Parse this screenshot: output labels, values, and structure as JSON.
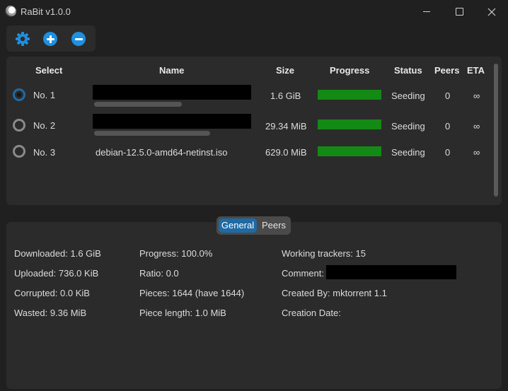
{
  "app": {
    "title": "RaBit v1.0.0",
    "accent_color": "#1f6aa5",
    "progress_color": "#138a13"
  },
  "toolbar": {
    "settings_icon": "gear-icon",
    "add_icon": "plus-circle-icon",
    "remove_icon": "minus-circle-icon"
  },
  "table": {
    "headers": {
      "select": "Select",
      "name": "Name",
      "size": "Size",
      "progress": "Progress",
      "status": "Status",
      "peers": "Peers",
      "eta": "ETA"
    },
    "rows": [
      {
        "select_label": "No. 1",
        "selected": true,
        "name": "",
        "name_redacted": true,
        "size": "1.6 GiB",
        "progress": 1.0,
        "status": "Seeding",
        "peers": "0",
        "eta": "∞"
      },
      {
        "select_label": "No. 2",
        "selected": false,
        "name": "",
        "name_redacted": true,
        "size": "29.34 MiB",
        "progress": 1.0,
        "status": "Seeding",
        "peers": "0",
        "eta": "∞"
      },
      {
        "select_label": "No. 3",
        "selected": false,
        "name": "debian-12.5.0-amd64-netinst.iso",
        "name_redacted": false,
        "size": "629.0 MiB",
        "progress": 1.0,
        "status": "Seeding",
        "peers": "0",
        "eta": "∞"
      }
    ]
  },
  "details": {
    "tabs": {
      "general": "General",
      "peers": "Peers",
      "active": "General"
    },
    "downloaded": "Downloaded: 1.6 GiB",
    "uploaded": "Uploaded: 736.0 KiB",
    "corrupted": "Corrupted: 0.0 KiB",
    "wasted": "Wasted: 9.36 MiB",
    "progress": "Progress: 100.0%",
    "ratio": "Ratio: 0.0",
    "pieces": "Pieces: 1644 (have 1644)",
    "piece_length": "Piece length: 1.0 MiB",
    "working_trackers": "Working trackers: 15",
    "comment_label": "Comment:",
    "created_by": "Created By: mktorrent 1.1",
    "creation_date": "Creation Date:"
  }
}
